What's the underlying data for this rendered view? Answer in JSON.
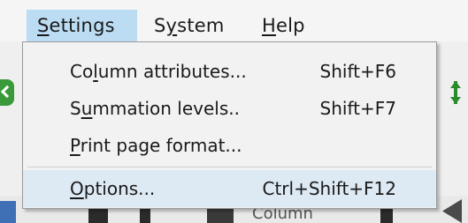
{
  "menubar": {
    "items": [
      {
        "label_pre": "",
        "mnemonic": "S",
        "label_post": "ettings",
        "active": true
      },
      {
        "label_pre": "S",
        "mnemonic": "y",
        "label_post": "stem",
        "active": false
      },
      {
        "label_pre": "",
        "mnemonic": "H",
        "label_post": "elp",
        "active": false
      }
    ]
  },
  "dropdown": {
    "items": [
      {
        "pre": "Co",
        "mnemonic": "l",
        "post": "umn attributes...",
        "shortcut": "Shift+F6",
        "highlighted": false
      },
      {
        "pre": "S",
        "mnemonic": "u",
        "post": "mmation levels..",
        "shortcut": "Shift+F7",
        "highlighted": false
      },
      {
        "pre": "",
        "mnemonic": "P",
        "post": "rint page format...",
        "shortcut": "",
        "highlighted": false
      },
      {
        "pre": "",
        "mnemonic": "O",
        "post": "ptions...",
        "shortcut": "Ctrl+Shift+F12",
        "highlighted": true
      }
    ]
  },
  "background": {
    "partial_text": "Column"
  },
  "colors": {
    "menubar_active_bg": "#bcdcf3",
    "menu_highlight_bg": "#dde9f3",
    "dropdown_bg": "#f2f2f2",
    "dropdown_border": "#9a9a9a"
  },
  "icons": {
    "left_toolbar": "green-double-chevron-icon",
    "right_toolbar": "green-expand-arrows-icon"
  }
}
